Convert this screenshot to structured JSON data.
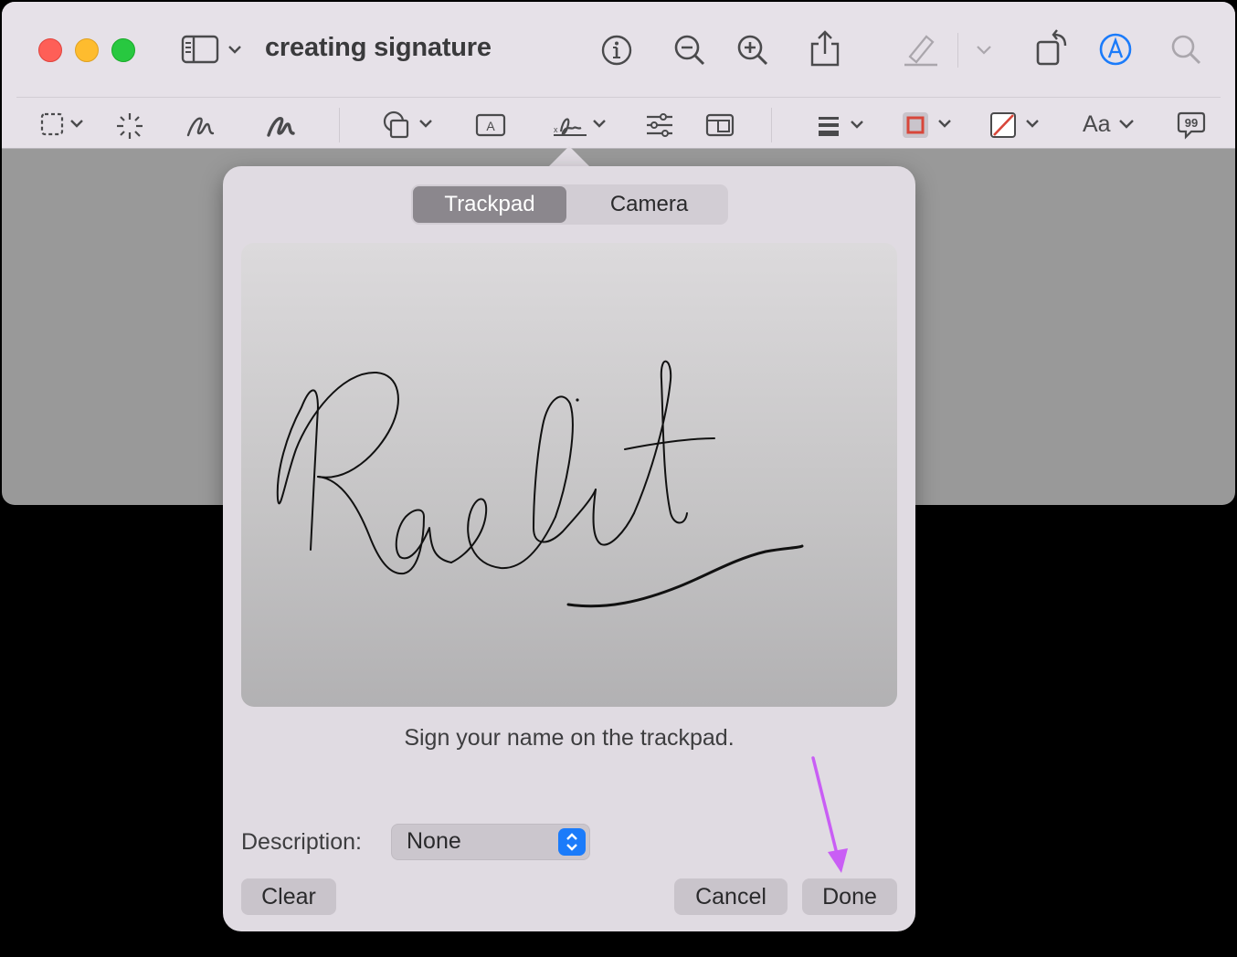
{
  "window": {
    "title": "creating signature",
    "traffic_lights": [
      "close",
      "minimize",
      "zoom"
    ]
  },
  "toolbar_top": {
    "icons": [
      "sidebar-icon",
      "info-icon",
      "zoom-out-icon",
      "zoom-in-icon",
      "share-icon",
      "highlight-pen-icon",
      "rotate-icon",
      "markup-icon",
      "search-icon"
    ]
  },
  "toolbar_markup": {
    "icons": [
      "rectangular-selection-icon",
      "instant-alpha-icon",
      "sketch-icon",
      "draw-icon",
      "shapes-icon",
      "text-box-icon",
      "signature-icon",
      "adjust-color-icon",
      "adjust-size-icon",
      "shape-style-icon",
      "border-color-icon",
      "fill-color-icon",
      "text-style-icon",
      "annotate-icon"
    ],
    "text_style_label": "Aa",
    "border_color": "#d8463a",
    "fill_color_slash": "#d8463a"
  },
  "signature_popover": {
    "tabs": [
      {
        "label": "Trackpad",
        "active": true
      },
      {
        "label": "Camera",
        "active": false
      }
    ],
    "hint": "Sign your name on the trackpad.",
    "description_label": "Description:",
    "description_value": "None",
    "buttons": {
      "clear": "Clear",
      "cancel": "Cancel",
      "done": "Done"
    }
  },
  "annotation": {
    "arrow_color": "#c95ef5",
    "points_to": "done-button"
  }
}
